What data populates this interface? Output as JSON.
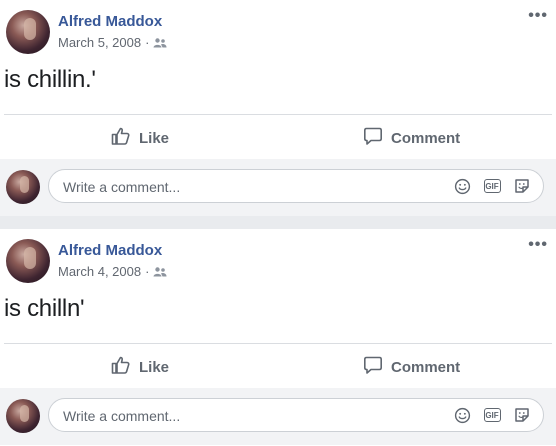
{
  "posts": [
    {
      "author": "Alfred Maddox",
      "date": "March 5, 2008",
      "separator": "·",
      "status": "is chillin.'",
      "like_label": "Like",
      "comment_label": "Comment",
      "comment_placeholder": "Write a comment..."
    },
    {
      "author": "Alfred Maddox",
      "date": "March 4, 2008",
      "separator": "·",
      "status": "is chilln'",
      "like_label": "Like",
      "comment_label": "Comment",
      "comment_placeholder": "Write a comment..."
    }
  ],
  "icons": [
    "friends-icon",
    "more-options-icon",
    "like-thumb-icon",
    "comment-bubble-icon",
    "emoji-icon",
    "gif-icon",
    "sticker-icon"
  ],
  "colors": {
    "author_link": "#385898",
    "meta_text": "#616770",
    "action_text": "#606770",
    "page_background": "#e9ebee"
  }
}
